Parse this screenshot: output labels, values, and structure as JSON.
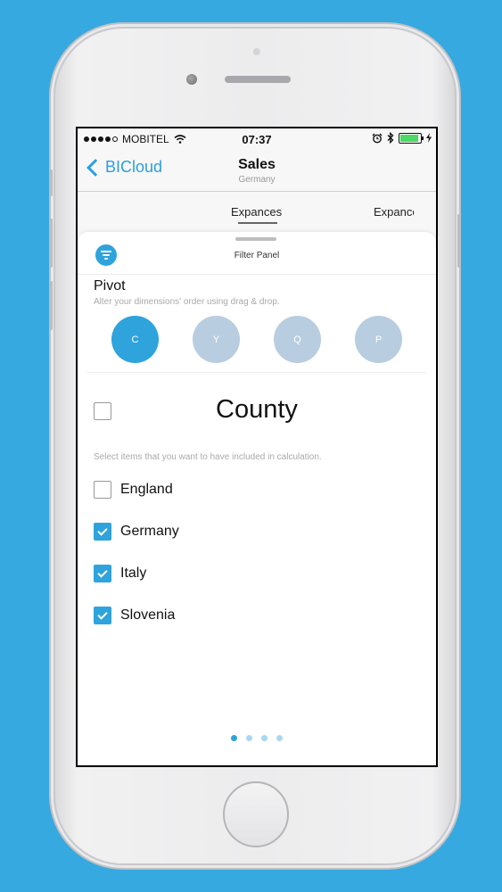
{
  "status_bar": {
    "carrier": "MOBITEL",
    "time": "07:37"
  },
  "navbar": {
    "back_label": "BICloud",
    "title": "Sales",
    "subtitle": "Germany"
  },
  "tabs": [
    {
      "label": "Expances",
      "selected": true
    },
    {
      "label": "Expances",
      "selected": false
    }
  ],
  "panel": {
    "title": "Filter Panel",
    "pivot_title": "Pivot",
    "pivot_subtitle": "Alter your dimensions' order using drag & drop.",
    "dimensions": [
      {
        "label": "C",
        "active": true
      },
      {
        "label": "Y",
        "active": false
      },
      {
        "label": "Q",
        "active": false
      },
      {
        "label": "P",
        "active": false
      }
    ],
    "field_title": "County",
    "select_all_checked": false,
    "hint": "Select items that you want to have included in calculation.",
    "items": [
      {
        "label": "England",
        "checked": false
      },
      {
        "label": "Germany",
        "checked": true
      },
      {
        "label": "Italy",
        "checked": true
      },
      {
        "label": "Slovenia",
        "checked": true
      }
    ],
    "pager": {
      "count": 4,
      "current": 1
    }
  },
  "colors": {
    "background": "#36a9e0",
    "accent": "#2fa3dc",
    "inactive_dimension": "#b8cde0"
  }
}
